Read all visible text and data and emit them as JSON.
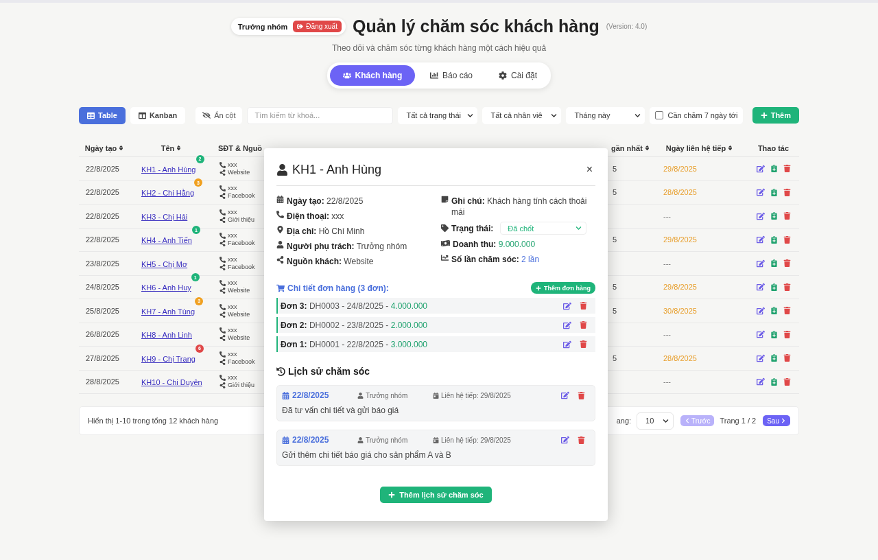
{
  "header": {
    "user": "Trưởng nhóm",
    "logout": "Đăng xuất",
    "title": "Quản lý chăm sóc khách hàng",
    "version": "(Version: 4.0)",
    "subtitle": "Theo dõi và chăm sóc từng khách hàng một cách hiệu quả"
  },
  "tabs": [
    {
      "kind": "customers",
      "label": "Khách hàng",
      "selected": true
    },
    {
      "kind": "reports",
      "label": "Báo cáo",
      "selected": false
    },
    {
      "kind": "settings",
      "label": "Cài đặt",
      "selected": false
    }
  ],
  "toolbar": {
    "views": [
      {
        "kind": "table",
        "label": "Table",
        "selected": true
      },
      {
        "kind": "kanban",
        "label": "Kanban",
        "selected": false
      }
    ],
    "hide_columns": "Ẩn cột",
    "search": {
      "placeholder": "Tìm kiếm từ khoá..."
    },
    "filters": [
      "Tất cả trạng thái",
      "Tất cả nhân viê",
      "Tháng này"
    ],
    "due_filter": {
      "label": "Cần chăm 7 ngày tới",
      "checked": false
    },
    "add": "Thêm"
  },
  "table": {
    "columns": [
      "Ngày tạo",
      "Tên",
      "SĐT & Nguồ",
      "gần nhất",
      "Ngày liên hệ tiếp",
      "Thao tác"
    ],
    "rows": [
      {
        "created": "22/8/2025",
        "name": "KH1 - Anh Hùng",
        "badge": {
          "text": "2",
          "color": "#1fb47a"
        },
        "phone": "xxx",
        "source": "Website",
        "column_4": "5",
        "next_contact": {
          "text": "29/8/2025",
          "highlight": true
        }
      },
      {
        "created": "22/8/2025",
        "name": "KH2 - Chị Hằng",
        "badge": {
          "text": "3",
          "color": "#f0a020"
        },
        "phone": "xxx",
        "source": "Facebook",
        "column_4": "5",
        "next_contact": {
          "text": "28/8/2025",
          "highlight": true
        }
      },
      {
        "created": "22/8/2025",
        "name": "KH3 - Chị Hải",
        "phone": "xxx",
        "source": "Giới thiệu",
        "next_contact": {
          "text": "---",
          "highlight": false
        }
      },
      {
        "created": "22/8/2025",
        "name": "KH4 - Anh Tiến",
        "badge": {
          "text": "1",
          "color": "#1fb47a"
        },
        "phone": "xxx",
        "source": "Facebook",
        "column_4": "5",
        "next_contact": {
          "text": "29/8/2025",
          "highlight": true
        }
      },
      {
        "created": "23/8/2025",
        "name": "KH5 - Chị Mơ",
        "phone": "xxx",
        "source": "Facebook",
        "next_contact": {
          "text": "---",
          "highlight": false
        }
      },
      {
        "created": "24/8/2025",
        "name": "KH6 - Anh Huy",
        "badge": {
          "text": "1",
          "color": "#1fb47a"
        },
        "phone": "xxx",
        "source": "Website",
        "column_4": "5",
        "next_contact": {
          "text": "29/8/2025",
          "highlight": true
        }
      },
      {
        "created": "25/8/2025",
        "name": "KH7 - Anh Tùng",
        "badge": {
          "text": "3",
          "color": "#f0a020"
        },
        "phone": "xxx",
        "source": "Website",
        "column_4": "5",
        "next_contact": {
          "text": "30/8/2025",
          "highlight": true
        }
      },
      {
        "created": "26/8/2025",
        "name": "KH8 - Anh Linh",
        "phone": "xxx",
        "source": "Website",
        "next_contact": {
          "text": "---",
          "highlight": false
        }
      },
      {
        "created": "27/8/2025",
        "name": "KH9 - Chị Trang",
        "badge": {
          "text": "6",
          "color": "#e04848"
        },
        "phone": "xxx",
        "source": "Facebook",
        "column_4": "5",
        "next_contact": {
          "text": "28/8/2025",
          "highlight": true
        }
      },
      {
        "created": "28/8/2025",
        "name": "KH10 - Chị Duyên",
        "phone": "xxx",
        "source": "Giới thiệu",
        "next_contact": {
          "text": "---",
          "highlight": false
        }
      }
    ]
  },
  "pagination": {
    "summary": "Hiển thị 1-10 trong tổng 12 khách hàng",
    "page_size_label": "ang:",
    "page_size": "10",
    "prev": {
      "label": "Trước",
      "disabled": true
    },
    "page": "Trang 1 / 2",
    "next": {
      "label": "Sau",
      "disabled": false
    }
  },
  "modal": {
    "title": "KH1 - Anh Hùng",
    "close": "×",
    "left_fields": [
      {
        "kind": "date",
        "label": "Ngày tạo:",
        "value": "22/8/2025"
      },
      {
        "kind": "phone",
        "label": "Điện thoại:",
        "value": "xxx"
      },
      {
        "kind": "address",
        "label": "Địa chỉ:",
        "value": "Hồ Chí Minh"
      },
      {
        "kind": "owner",
        "label": "Người phụ trách:",
        "value": "Trưởng nhóm"
      },
      {
        "kind": "source",
        "label": "Nguồn khách:",
        "value": "Website"
      }
    ],
    "note": {
      "label": "Ghi chú:",
      "value": "Khách hàng tính cách thoải mái"
    },
    "status": {
      "label": "Trạng thái:",
      "value": "Đã chốt"
    },
    "revenue": {
      "label": "Doanh thu:",
      "value": "9.000.000"
    },
    "care_count": {
      "label": "Số lần chăm sóc:",
      "value": "2 lần"
    },
    "orders": {
      "title": "Chi tiết đơn hàng (3 đơn):",
      "add": "Thêm đơn hàng",
      "items": [
        {
          "label": "Đơn 3:",
          "detail": "DH0003 - 24/8/2025 -",
          "amount": "4.000.000"
        },
        {
          "label": "Đơn 2:",
          "detail": "DH0002 - 23/8/2025 -",
          "amount": "2.000.000"
        },
        {
          "label": "Đơn 1:",
          "detail": "DH0001 - 22/8/2025 -",
          "amount": "3.000.000"
        }
      ]
    },
    "history": {
      "title": "Lịch sử chăm sóc",
      "items": [
        {
          "date": "22/8/2025",
          "owner": "Trưởng nhóm",
          "next": "Liên hệ tiếp: 29/8/2025",
          "note": "Đã tư vấn chi tiết và gửi báo giá"
        },
        {
          "date": "22/8/2025",
          "owner": "Trưởng nhóm",
          "next": "Liên hệ tiếp: 29/8/2025",
          "note": "Gửi thêm chi tiết báo giá cho sản phẩm A và B"
        }
      ],
      "add": "Thêm lịch sử chăm sóc"
    }
  }
}
